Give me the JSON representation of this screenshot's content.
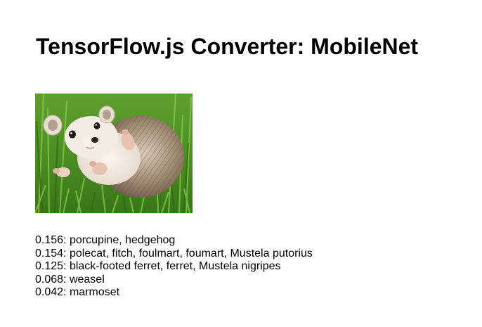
{
  "page": {
    "title": "TensorFlow.js Converter: MobileNet"
  },
  "image": {
    "subject": "hedgehog lying on its back in green grass"
  },
  "predictions": [
    {
      "score": "0.156",
      "label": "porcupine, hedgehog"
    },
    {
      "score": "0.154",
      "label": "polecat, fitch, foulmart, foumart, Mustela putorius"
    },
    {
      "score": "0.125",
      "label": "black-footed ferret, ferret, Mustela nigripes"
    },
    {
      "score": "0.068",
      "label": "weasel"
    },
    {
      "score": "0.042",
      "label": "marmoset"
    }
  ],
  "colors": {
    "grass_dark": "#3d7a1f",
    "grass_light": "#7fc043",
    "spines": "#8a7460",
    "fur": "#efe6dc",
    "nose": "#2a2220"
  }
}
